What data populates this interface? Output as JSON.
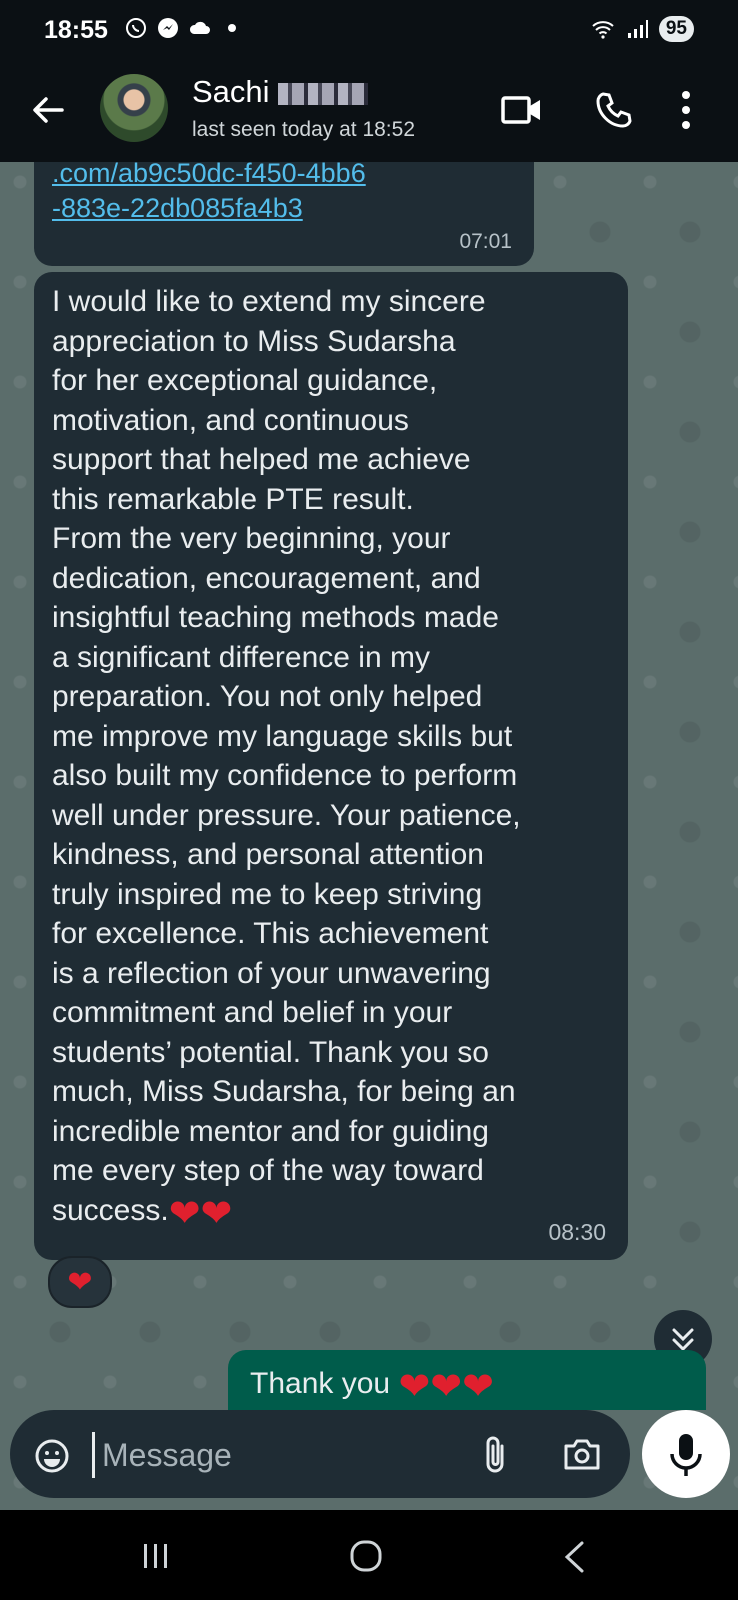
{
  "status_bar": {
    "time": "18:55",
    "battery": "95",
    "notification_icons": [
      "whatsapp-icon",
      "messenger-icon",
      "cloud-icon",
      "dot-icon"
    ],
    "system_icons": [
      "wifi-icon",
      "signal-icon"
    ]
  },
  "header": {
    "contact_name": "Sachi",
    "last_seen": "last seen today at 18:52",
    "icons": [
      "back-arrow-icon",
      "video-call-icon",
      "phone-icon",
      "more-vert-icon"
    ]
  },
  "messages": [
    {
      "direction": "incoming",
      "link_lines": [
        ".com/ab9c50dc-f450-4bb6",
        "-883e-22db085fa4b3"
      ],
      "time": "07:01"
    },
    {
      "direction": "incoming",
      "text": "I would like to extend my sincere\nappreciation to Miss Sudarsha\nfor her exceptional guidance,\nmotivation, and continuous\nsupport that helped me achieve\nthis remarkable PTE result.\nFrom the very beginning, your\ndedication, encouragement, and\ninsightful teaching methods made\na significant difference in my\npreparation. You not only helped\nme improve my language skills but\nalso built my confidence to perform\nwell under pressure. Your patience,\nkindness, and personal attention\ntruly inspired me to keep striving\nfor excellence. This achievement\nis a reflection of your unwavering\ncommitment and belief in your\nstudents’ potential. Thank you so\nmuch, Miss Sudarsha, for being an\nincredible mentor and for guiding\nme every step of the way toward\nsuccess.",
      "emoji": "❤❤",
      "time": "08:30",
      "reaction": "❤"
    },
    {
      "direction": "outgoing",
      "text": "Thank you",
      "emoji": "❤❤❤"
    }
  ],
  "composer": {
    "placeholder": "Message",
    "icons": [
      "emoji-icon",
      "attach-icon",
      "camera-icon",
      "mic-icon"
    ]
  },
  "colors": {
    "header_bg": "#0b1014",
    "incoming_bubble": "#1f2c34",
    "outgoing_bubble": "#005c4b",
    "link": "#53bdeb",
    "chat_wallpaper": "#5b6d6b"
  }
}
